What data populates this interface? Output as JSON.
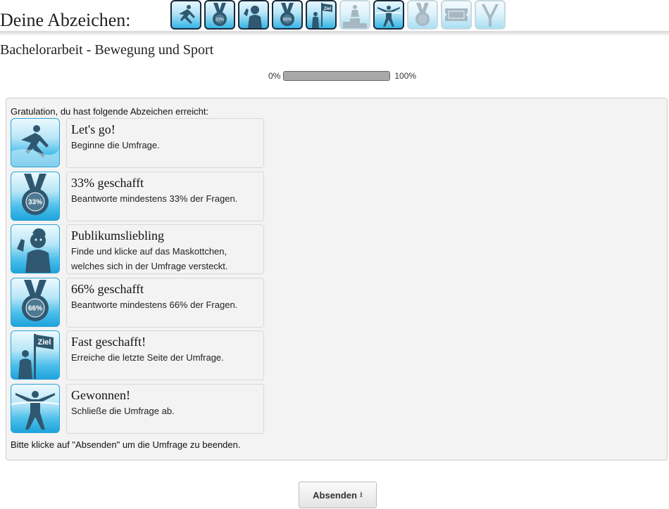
{
  "header": {
    "title": "Deine Abzeichen:",
    "badges": [
      {
        "icon": "runner-start-icon",
        "earned": true
      },
      {
        "icon": "medal-33-icon",
        "earned": true
      },
      {
        "icon": "mascot-icon",
        "earned": true
      },
      {
        "icon": "medal-66-icon",
        "earned": true
      },
      {
        "icon": "ziel-flag-icon",
        "earned": true
      },
      {
        "icon": "podium-icon",
        "earned": false
      },
      {
        "icon": "finish-line-icon",
        "earned": true
      },
      {
        "icon": "medal-100-icon",
        "earned": false
      },
      {
        "icon": "ticket-icon",
        "earned": false
      },
      {
        "icon": "slingshot-icon",
        "earned": false
      }
    ]
  },
  "survey": {
    "title": "Bachelorarbeit - Bewegung und Sport"
  },
  "progress": {
    "min_label": "0%",
    "max_label": "100%",
    "value": 1.0
  },
  "awards_panel": {
    "intro": "Gratulation, du hast folgende Abzeichen erreicht:",
    "awards": [
      {
        "title": "Let's go!",
        "desc": "Beginne die Umfrage.",
        "icon": "runner-start-icon"
      },
      {
        "title": "33% geschafft",
        "desc": "Beantworte mindestens 33% der Fragen.",
        "icon": "medal-33-icon",
        "medal_label": "33%"
      },
      {
        "title": "Publikumsliebling",
        "desc": "Finde und klicke auf das Maskottchen, welches sich in der Umfrage versteckt.",
        "icon": "mascot-icon"
      },
      {
        "title": "66% geschafft",
        "desc": "Beantworte mindestens 66% der Fragen.",
        "icon": "medal-66-icon",
        "medal_label": "66%"
      },
      {
        "title": "Fast geschafft!",
        "desc": "Erreiche die letzte Seite der Umfrage.",
        "icon": "ziel-flag-icon",
        "flag_label": "Ziel"
      },
      {
        "title": "Gewonnen!",
        "desc": "Schließe die Umfrage ab.",
        "icon": "finish-line-icon"
      }
    ],
    "outro": "Bitte klicke auf \"Absenden\" um die Umfrage zu beenden."
  },
  "submit": {
    "label": "Absenden",
    "glyph": "⭳"
  },
  "colors": {
    "badge_blue": "#35b4e6",
    "silhouette": "#2f5870",
    "progress_fill": "#a8a8a8"
  }
}
